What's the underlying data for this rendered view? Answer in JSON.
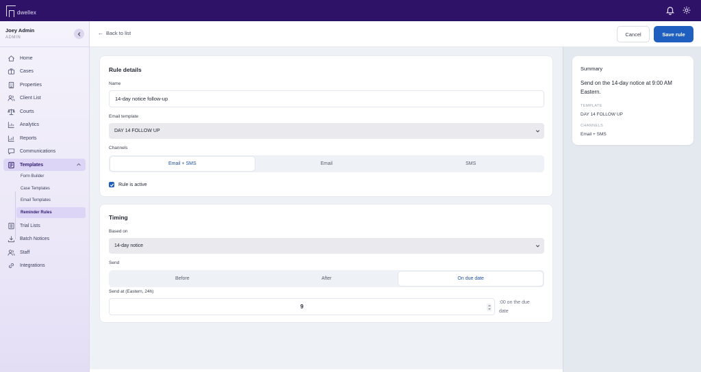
{
  "app": {
    "logo_text": "dwellex"
  },
  "user": {
    "name": "Joey Admin",
    "role": "ADMIN"
  },
  "nav": {
    "items": [
      {
        "label": "Home",
        "icon": "home-icon"
      },
      {
        "label": "Cases",
        "icon": "briefcase-icon"
      },
      {
        "label": "Properties",
        "icon": "building-icon"
      },
      {
        "label": "Client List",
        "icon": "users-icon"
      },
      {
        "label": "Courts",
        "icon": "scale-icon"
      },
      {
        "label": "Analytics",
        "icon": "bar-chart-icon"
      },
      {
        "label": "Reports",
        "icon": "report-icon"
      },
      {
        "label": "Communications",
        "icon": "chat-icon"
      },
      {
        "label": "Templates",
        "icon": "document-icon"
      },
      {
        "label": "Trial Lists",
        "icon": "list-icon"
      },
      {
        "label": "Batch Notices",
        "icon": "download-icon"
      },
      {
        "label": "Staff",
        "icon": "staff-icon"
      },
      {
        "label": "Integrations",
        "icon": "link-icon"
      }
    ],
    "sub_items": [
      {
        "label": "Form Builder"
      },
      {
        "label": "Case Templates"
      },
      {
        "label": "Email Templates"
      },
      {
        "label": "Reminder Rules"
      }
    ]
  },
  "header": {
    "back_label": "Back to list",
    "cancel_label": "Cancel",
    "save_label": "Save rule"
  },
  "rule_details": {
    "title": "Rule details",
    "name_label": "Name",
    "name_value": "14-day notice follow-up",
    "template_label": "Email template",
    "template_value": "DAY 14 FOLLOW UP",
    "channels_label": "Channels",
    "channels": [
      "Email + SMS",
      "Email",
      "SMS"
    ],
    "active_label": "Rule is active"
  },
  "timing": {
    "title": "Timing",
    "based_on_label": "Based on",
    "based_on_value": "14-day notice",
    "send_label": "Send",
    "send_options": [
      "Before",
      "After",
      "On due date"
    ],
    "send_at_label": "Send at (Eastern, 24h)",
    "send_at_value": "9",
    "suffix_line1": ":00 on the due",
    "suffix_line2": "date"
  },
  "summary": {
    "title": "Summary",
    "text": "Send on the 14-day notice at 9:00 AM Eastern.",
    "template_label": "TEMPLATE",
    "template_value": "DAY 14 FOLLOW UP",
    "channels_label": "CHANNELS",
    "channels_value": "Email + SMS"
  },
  "colors": {
    "topbar": "#2d1268",
    "primary": "#1f5fbf",
    "active_nav": "#ddd5f6"
  }
}
